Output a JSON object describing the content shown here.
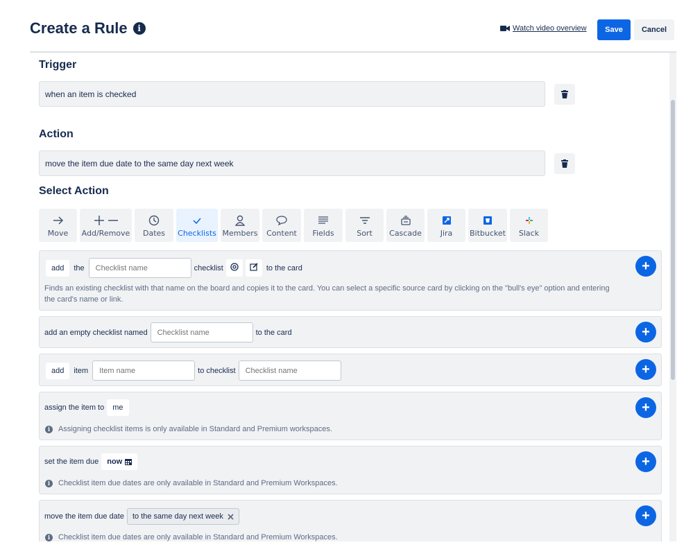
{
  "header": {
    "title": "Create a Rule",
    "video_link": "Watch video overview",
    "save": "Save",
    "cancel": "Cancel"
  },
  "trigger": {
    "heading": "Trigger",
    "text": "when an item is checked"
  },
  "action": {
    "heading": "Action",
    "text": "move the item due date to the same day next week"
  },
  "select_action": {
    "heading": "Select Action",
    "tabs": [
      {
        "label": "Move",
        "icon": "arrow-right-icon"
      },
      {
        "label": "Add/Remove",
        "icon": "plus-minus-icon"
      },
      {
        "label": "Dates",
        "icon": "clock-icon"
      },
      {
        "label": "Checklists",
        "icon": "check-icon",
        "active": true
      },
      {
        "label": "Members",
        "icon": "person-icon"
      },
      {
        "label": "Content",
        "icon": "speech-bubble-icon"
      },
      {
        "label": "Fields",
        "icon": "lines-icon"
      },
      {
        "label": "Sort",
        "icon": "filter-icon"
      },
      {
        "label": "Cascade",
        "icon": "stack-icon"
      },
      {
        "label": "Jira",
        "icon": "jira-icon"
      },
      {
        "label": "Bitbucket",
        "icon": "bitbucket-icon"
      },
      {
        "label": "Slack",
        "icon": "slack-icon"
      }
    ]
  },
  "options": {
    "opt1": {
      "add": "add",
      "the": "the",
      "placeholder": "Checklist name",
      "checklist": "checklist",
      "to_card": "to the card",
      "description": "Finds an existing checklist with that name on the board and copies it to the card. You can select a specific source card by clicking on the \"bull's eye\" option and entering the card's name or link."
    },
    "opt2": {
      "prefix": "add an empty checklist named",
      "placeholder": "Checklist name",
      "suffix": "to the card"
    },
    "opt3": {
      "add": "add",
      "item": "item",
      "item_placeholder": "Item name",
      "to_checklist": "to checklist",
      "checklist_placeholder": "Checklist name"
    },
    "opt4": {
      "prefix": "assign the item to",
      "value": "me",
      "note": "Assigning checklist items is only available in Standard and Premium workspaces."
    },
    "opt5": {
      "prefix": "set the item due",
      "value": "now",
      "note": "Checklist item due dates are only available in Standard and Premium Workspaces."
    },
    "opt6": {
      "prefix": "move the item due date",
      "value": "to the same day next week",
      "note": "Checklist item due dates are only available in Standard and Premium Workspaces."
    }
  },
  "colors": {
    "primary": "#0c66e4",
    "panel_bg": "#f1f2f4",
    "text": "#172b4d"
  }
}
